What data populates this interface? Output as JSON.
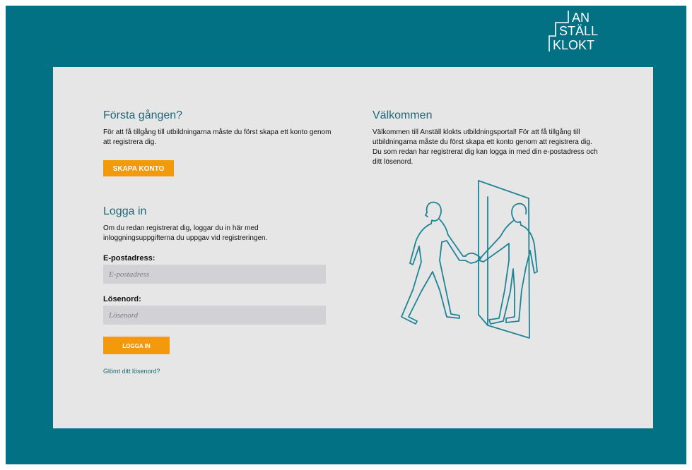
{
  "brand": {
    "logo_line1": "AN",
    "logo_line2": "STÄLL",
    "logo_line3": "KLOKT"
  },
  "first_time": {
    "heading": "Första gången?",
    "text": "För att få tillgång till utbildningarna måste du först skapa ett konto genom att registrera dig.",
    "create_button": "SKAPA KONTO"
  },
  "login": {
    "heading": "Logga in",
    "text": "Om du redan registrerat dig, loggar du in här med inloggningsuppgifterna du uppgav vid registreringen.",
    "email_label": "E-postadress:",
    "email_placeholder": "E-postadress",
    "password_label": "Lösenord:",
    "password_placeholder": "Lösenord",
    "login_button": "LOGGA IN",
    "forgot_link": "Glömt ditt lösenord?"
  },
  "welcome": {
    "heading": "Välkommen",
    "text": "Välkommen till Anställ klokts utbildningsportal! För att få tillgång till utbildningarna måste du först skapa ett konto genom att registrera dig. Du som redan har registrerat dig kan logga in med din e-postadress och ditt lösenord."
  },
  "colors": {
    "background": "#027183",
    "accent": "#f29a0b",
    "card": "#e6e6e6",
    "heading": "#1b6a79"
  }
}
